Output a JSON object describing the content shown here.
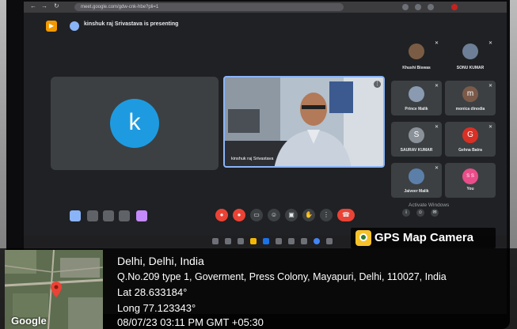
{
  "meeting": {
    "presenting_text": "kinshuk raj Srivastava is presenting",
    "main_avatar_letter": "k",
    "video_participant_name": "kinshuk raj Srivastava",
    "activate_text": "Activate Windows"
  },
  "participants": [
    {
      "name": "Khushi Biswas",
      "initial": "",
      "color": "#7a5c45"
    },
    {
      "name": "SONU KUMAR",
      "initial": "",
      "color": "#6d7f96"
    },
    {
      "name": "Prince Malik",
      "initial": "",
      "color": "#8a9ab0"
    },
    {
      "name": "monica dinodia",
      "initial": "m",
      "color": "#7b5a4a"
    },
    {
      "name": "SAURAV KUMAR",
      "initial": "S",
      "color": "#8b9199"
    },
    {
      "name": "Gehna Batra",
      "initial": "G",
      "color": "#d93025"
    },
    {
      "name": "Jaiveer Malik",
      "initial": "",
      "color": "#5b7fa8"
    },
    {
      "name": "You",
      "initial": "S S",
      "color": "#e94d8a"
    }
  ],
  "browser": {
    "url": "meet.google.com/gdw-cnk-hbe?pli=1"
  },
  "gps": {
    "brand": "GPS Map Camera",
    "city": "Delhi, Delhi, India",
    "address": "Q.No.209 type 1, Goverment, Press Colony, Mayapuri, Delhi, 110027, India",
    "lat": "Lat 28.633184°",
    "long": "Long 77.123343°",
    "datetime": "08/07/23 03:11 PM GMT +05:30",
    "map_label": "Google"
  },
  "colors": {
    "accent": "#8ab4f8",
    "end_call": "#ea4335",
    "avatar_k": "#1e9be0"
  }
}
